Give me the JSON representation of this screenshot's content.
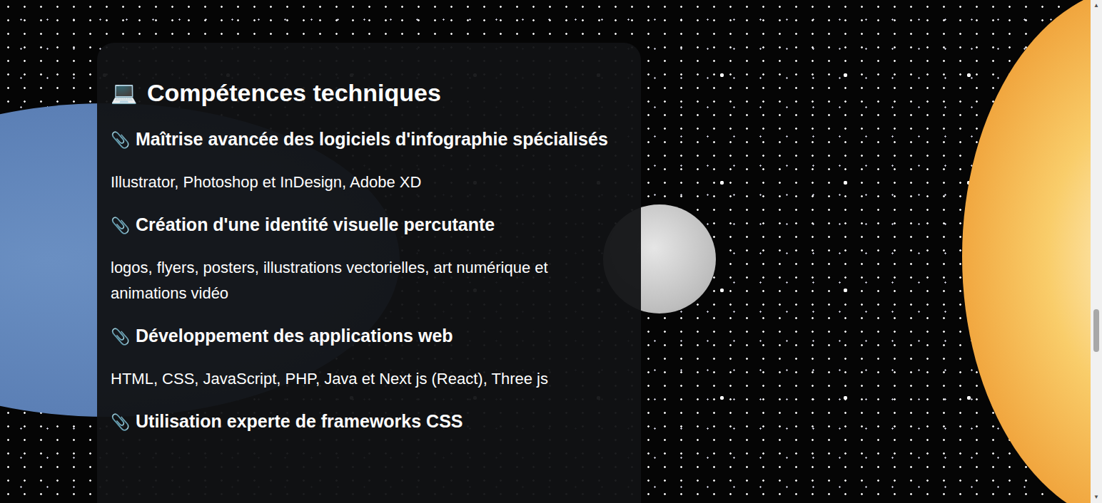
{
  "section": {
    "icon": "💻",
    "title": "Compétences techniques"
  },
  "skills": [
    {
      "icon": "📎",
      "title": "Maîtrise avancée des logiciels d'infographie spécialisés",
      "description": "Illustrator, Photoshop et InDesign, Adobe XD"
    },
    {
      "icon": "📎",
      "title": "Création d'une identité visuelle percutante",
      "description": "logos, flyers, posters, illustrations vectorielles, art numérique et animations vidéo"
    },
    {
      "icon": "📎",
      "title": "Développement des applications web",
      "description": "HTML, CSS, JavaScript, PHP, Java et Next js (React), Three js"
    },
    {
      "icon": "📎",
      "title": "Utilisation experte de frameworks CSS",
      "description": ""
    }
  ],
  "scrollbar": {
    "up": "▲",
    "down": "▼",
    "level": 0.68
  }
}
